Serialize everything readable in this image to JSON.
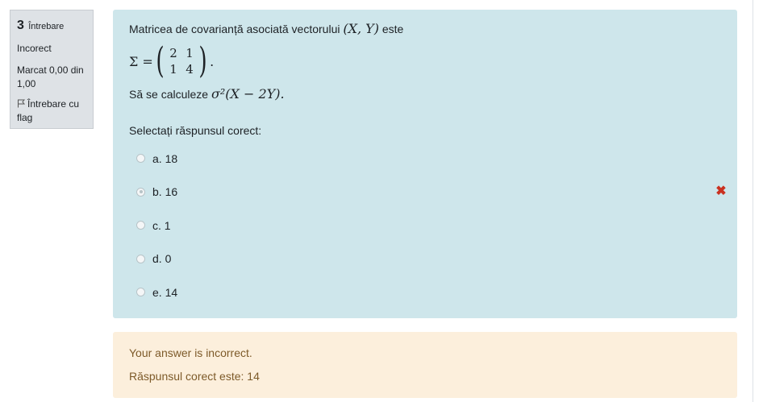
{
  "info": {
    "number": "3",
    "label": "Întrebare",
    "state": "Incorect",
    "grade": "Marcat 0,00 din 1,00",
    "flag_label": "Întrebare cu flag"
  },
  "question": {
    "intro": "Matricea de covarianță asociată vectorului",
    "vector": "(X, Y)",
    "intro_end": "este",
    "sigma": "Σ =",
    "matrix": [
      "2",
      "1",
      "1",
      "4"
    ],
    "matrix_dot": ".",
    "task": "Să se calculeze",
    "expr": "σ²(X − 2Y).",
    "prompt": "Selectați răspunsul corect:",
    "answers": [
      {
        "label": "a. 18",
        "checked": false
      },
      {
        "label": "b. 16",
        "checked": true,
        "incorrect": true
      },
      {
        "label": "c. 1",
        "checked": false
      },
      {
        "label": "d. 0",
        "checked": false
      },
      {
        "label": "e. 14",
        "checked": false
      }
    ],
    "incorrect_mark": "✖"
  },
  "feedback": {
    "message": "Your answer is incorrect.",
    "correct": "Răspunsul corect este: 14"
  },
  "colors": {
    "question_bg": "#cee6eb",
    "feedback_bg": "#fcefdc",
    "feedback_text": "#7d5a29",
    "info_bg": "#dee2e6",
    "incorrect": "#ca3120"
  }
}
